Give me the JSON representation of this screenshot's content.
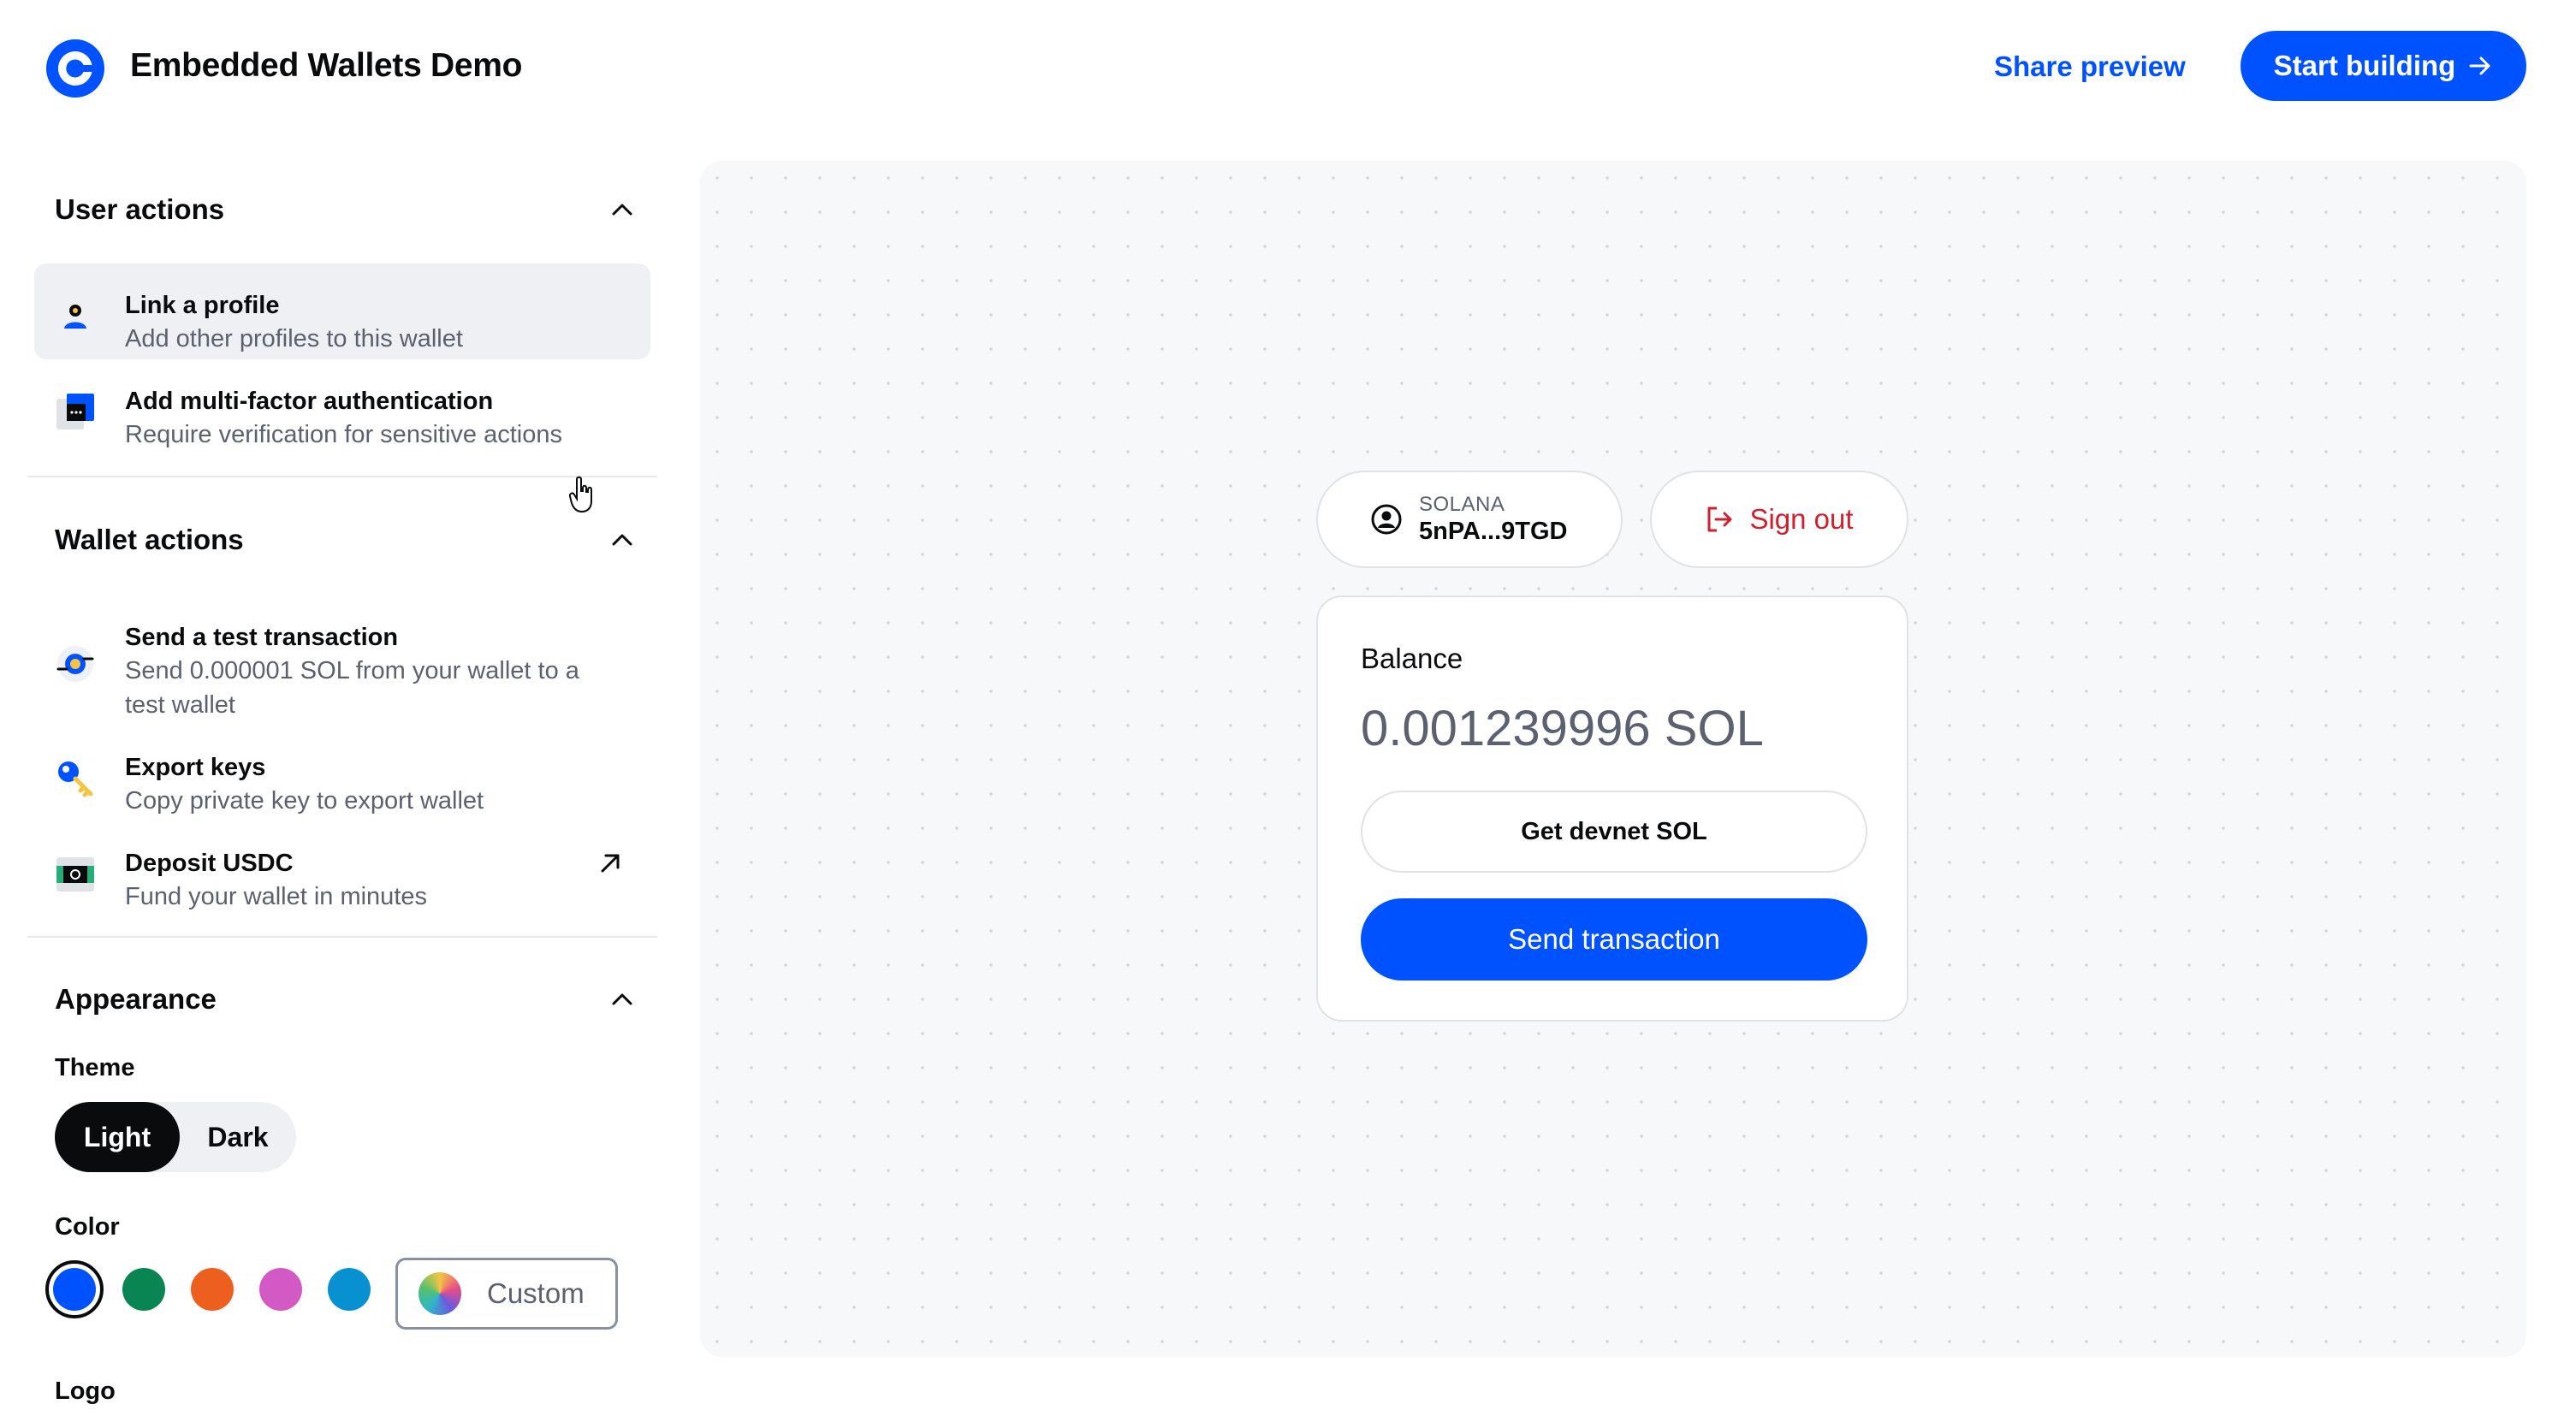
{
  "header": {
    "title": "Embedded Wallets Demo",
    "share_label": "Share preview",
    "start_label": "Start building"
  },
  "sidebar": {
    "user_actions": {
      "title": "User actions",
      "items": [
        {
          "title": "Link a profile",
          "desc": "Add other profiles to this wallet",
          "icon": "profile-icon"
        },
        {
          "title": "Add multi-factor authentication",
          "desc": "Require verification for sensitive actions",
          "icon": "mfa-icon"
        }
      ]
    },
    "wallet_actions": {
      "title": "Wallet actions",
      "items": [
        {
          "title": "Send a test transaction",
          "desc_line1": "Send 0.000001 SOL from your wallet to a",
          "desc_line2": "test wallet",
          "icon": "transaction-icon"
        },
        {
          "title": "Export keys",
          "desc": "Copy private key to export wallet",
          "icon": "key-icon"
        },
        {
          "title": "Deposit USDC",
          "desc": "Fund your wallet in minutes",
          "icon": "cash-icon"
        }
      ]
    },
    "appearance": {
      "title": "Appearance",
      "theme_label": "Theme",
      "theme_options": [
        "Light",
        "Dark"
      ],
      "theme_selected": "Light",
      "color_label": "Color",
      "colors": [
        "#0052ff",
        "#098551",
        "#ed5f1e",
        "#d359c4",
        "#0891d1"
      ],
      "color_selected": "#0052ff",
      "custom_label": "Custom",
      "logo_label": "Logo"
    }
  },
  "preview": {
    "network": "SOLANA",
    "address": "5nPA...9TGD",
    "signout_label": "Sign out",
    "balance_label": "Balance",
    "balance_value": "0.001239996 SOL",
    "get_sol_label": "Get devnet SOL",
    "send_label": "Send transaction"
  }
}
